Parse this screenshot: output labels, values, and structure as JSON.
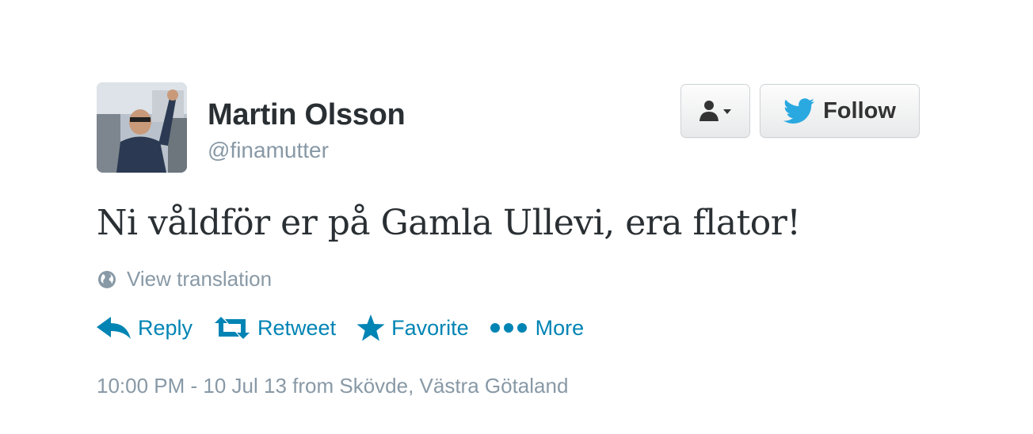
{
  "profile": {
    "name": "Martin Olsson",
    "handle": "@finamutter"
  },
  "buttons": {
    "user_actions_icon": "user-dropdown-icon",
    "follow_label": "Follow",
    "follow_icon": "twitter-bird-icon"
  },
  "tweet": {
    "text": "Ni våldför er på Gamla Ullevi, era flator!",
    "translate_label": "View translation",
    "timestamp": "10:00 PM - 10 Jul 13 from Skövde, Västra Götaland"
  },
  "actions": [
    {
      "label": "Reply",
      "icon": "reply-icon"
    },
    {
      "label": "Retweet",
      "icon": "retweet-icon"
    },
    {
      "label": "Favorite",
      "icon": "star-icon"
    },
    {
      "label": "More",
      "icon": "more-dots-icon"
    }
  ],
  "colors": {
    "link": "#0084b4",
    "muted": "#8899a6",
    "text": "#292f33",
    "twitter_blue": "#2aa9e0"
  }
}
